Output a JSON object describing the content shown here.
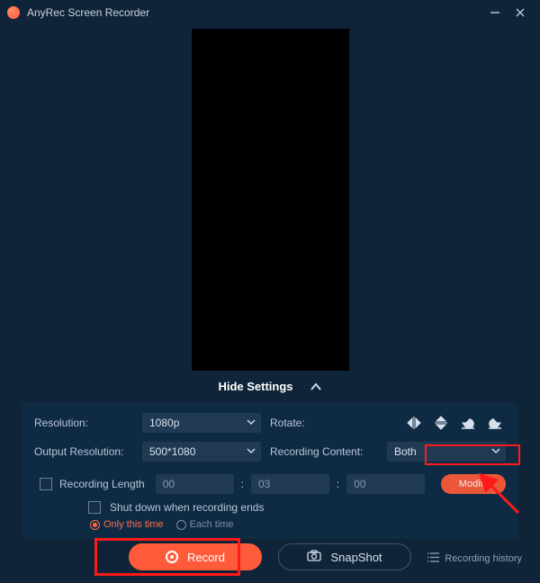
{
  "titlebar": {
    "title": "AnyRec Screen Recorder"
  },
  "toggle": {
    "label": "Hide Settings"
  },
  "settings": {
    "resolution_label": "Resolution:",
    "resolution_value": "1080p",
    "rotate_label": "Rotate:",
    "output_resolution_label": "Output Resolution:",
    "output_resolution_value": "500*1080",
    "recording_content_label": "Recording Content:",
    "recording_content_value": "Both"
  },
  "recording_length": {
    "label": "Recording Length",
    "hh": "00",
    "mm": "03",
    "ss": "00",
    "modify_label": "Modify"
  },
  "shutdown": {
    "label": "Shut down when recording ends",
    "only_this_time": "Only this time",
    "each_time": "Each time"
  },
  "buttons": {
    "record": "Record",
    "snapshot": "SnapShot",
    "history": "Recording history"
  }
}
